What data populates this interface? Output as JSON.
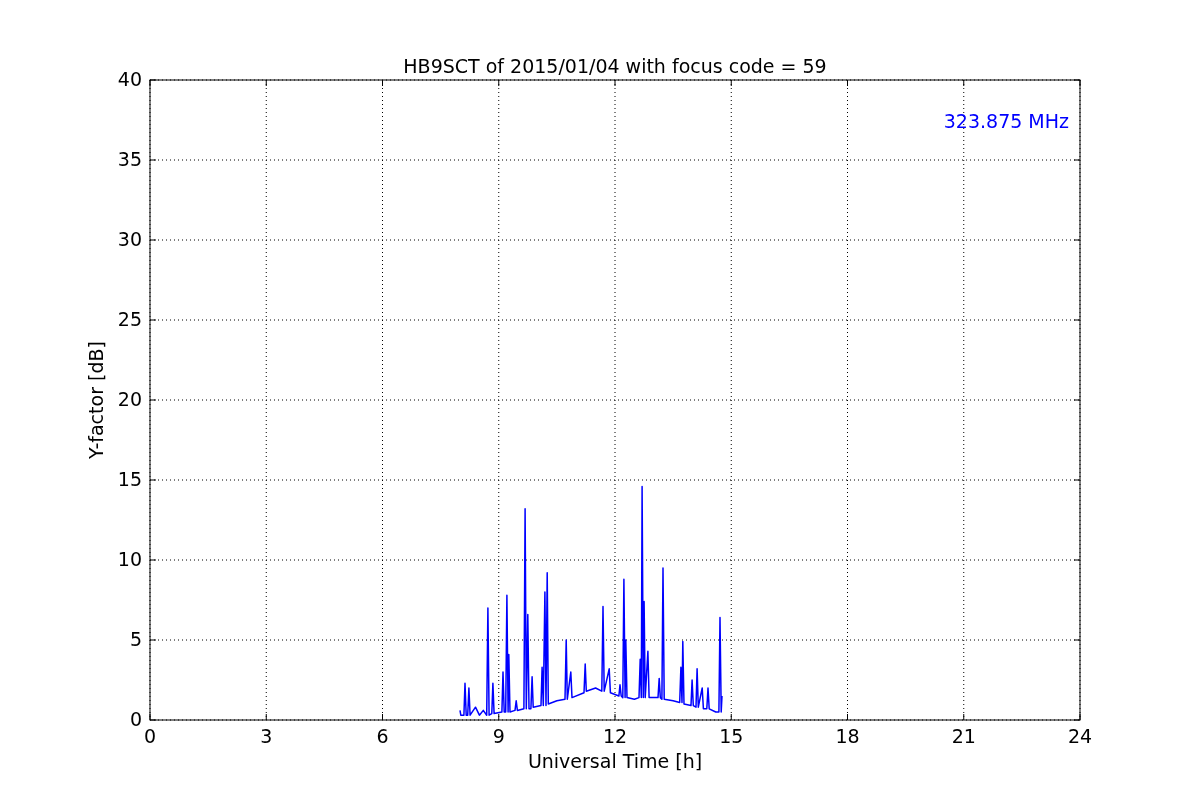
{
  "chart_data": {
    "type": "line",
    "title": "HB9SCT of 2015/01/04 with focus code = 59",
    "xlabel": "Universal Time [h]",
    "ylabel": "Y-factor [dB]",
    "xlim": [
      0,
      24
    ],
    "ylim": [
      0,
      40
    ],
    "grid": true,
    "xticks": [
      0,
      3,
      6,
      9,
      12,
      15,
      18,
      21,
      24
    ],
    "yticks": [
      0,
      5,
      10,
      15,
      20,
      25,
      30,
      35,
      40
    ],
    "x": [
      8.0,
      8.02,
      8.1,
      8.13,
      8.16,
      8.2,
      8.23,
      8.26,
      8.4,
      8.5,
      8.6,
      8.69,
      8.72,
      8.75,
      8.82,
      8.85,
      8.88,
      9.08,
      9.11,
      9.14,
      9.18,
      9.21,
      9.24,
      9.26,
      9.29,
      9.42,
      9.45,
      9.48,
      9.65,
      9.68,
      9.71,
      9.75,
      9.78,
      9.83,
      9.86,
      9.89,
      10.09,
      10.12,
      10.15,
      10.19,
      10.22,
      10.25,
      10.28,
      10.5,
      10.71,
      10.74,
      10.77,
      10.86,
      10.89,
      11.2,
      11.23,
      11.26,
      11.5,
      11.66,
      11.69,
      11.72,
      11.85,
      11.88,
      12.1,
      12.13,
      12.16,
      12.2,
      12.23,
      12.26,
      12.28,
      12.31,
      12.5,
      12.62,
      12.65,
      12.68,
      12.7,
      12.73,
      12.75,
      12.78,
      12.85,
      12.88,
      13.11,
      13.14,
      13.17,
      13.21,
      13.24,
      13.27,
      13.5,
      13.67,
      13.7,
      13.73,
      13.75,
      13.78,
      13.96,
      13.99,
      14.02,
      14.09,
      14.12,
      14.15,
      14.25,
      14.28,
      14.37,
      14.4,
      14.43,
      14.6,
      14.68,
      14.71,
      14.74,
      14.76
    ],
    "series": [
      {
        "name": "323.875 MHz",
        "color": "#0000ff",
        "values": [
          0.6,
          0.3,
          0.3,
          2.3,
          0.3,
          0.3,
          2.0,
          0.3,
          0.8,
          0.3,
          0.6,
          0.3,
          7.0,
          0.3,
          0.4,
          2.3,
          0.4,
          0.5,
          3.0,
          0.5,
          0.5,
          7.8,
          0.5,
          4.1,
          0.5,
          0.6,
          1.2,
          0.6,
          0.7,
          13.2,
          0.7,
          6.6,
          0.7,
          0.7,
          2.7,
          0.8,
          0.9,
          3.3,
          0.9,
          8.0,
          0.9,
          9.2,
          1.0,
          1.2,
          1.3,
          5.0,
          1.3,
          3.0,
          1.4,
          1.7,
          3.5,
          1.8,
          2.0,
          1.8,
          7.1,
          1.8,
          3.2,
          1.7,
          1.5,
          2.2,
          1.5,
          1.4,
          8.8,
          1.4,
          5.0,
          1.4,
          1.3,
          1.4,
          3.8,
          1.4,
          14.6,
          1.4,
          7.4,
          1.4,
          4.3,
          1.4,
          1.4,
          2.6,
          1.4,
          1.3,
          9.5,
          1.3,
          1.2,
          1.1,
          3.3,
          1.1,
          4.9,
          1.0,
          0.9,
          2.5,
          0.9,
          0.8,
          3.2,
          0.8,
          2.0,
          0.7,
          0.7,
          2.0,
          0.7,
          0.5,
          0.5,
          6.4,
          0.5,
          1.5
        ]
      }
    ]
  }
}
